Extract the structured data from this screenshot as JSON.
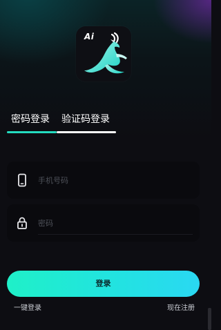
{
  "logo": {
    "badge_text": "Ai",
    "icon": "leaping-antelope-logo",
    "colors": {
      "gradient_start": "#9ef2e8",
      "gradient_end": "#1fd4c5"
    }
  },
  "tabs": [
    {
      "label": "密码登录",
      "active": true
    },
    {
      "label": "验证码登录",
      "active": false
    }
  ],
  "form": {
    "phone": {
      "placeholder": "手机号码",
      "value": "",
      "icon": "phone-icon"
    },
    "password": {
      "placeholder": "密码",
      "value": "",
      "icon": "lock-icon"
    }
  },
  "actions": {
    "login_label": "登录",
    "one_click_label": "一键登录",
    "register_label": "现在注册"
  },
  "colors": {
    "accent": "#24dcc0",
    "button_start": "#1ff0c8",
    "button_end": "#2ad8f2",
    "background": "#0d0d12"
  }
}
